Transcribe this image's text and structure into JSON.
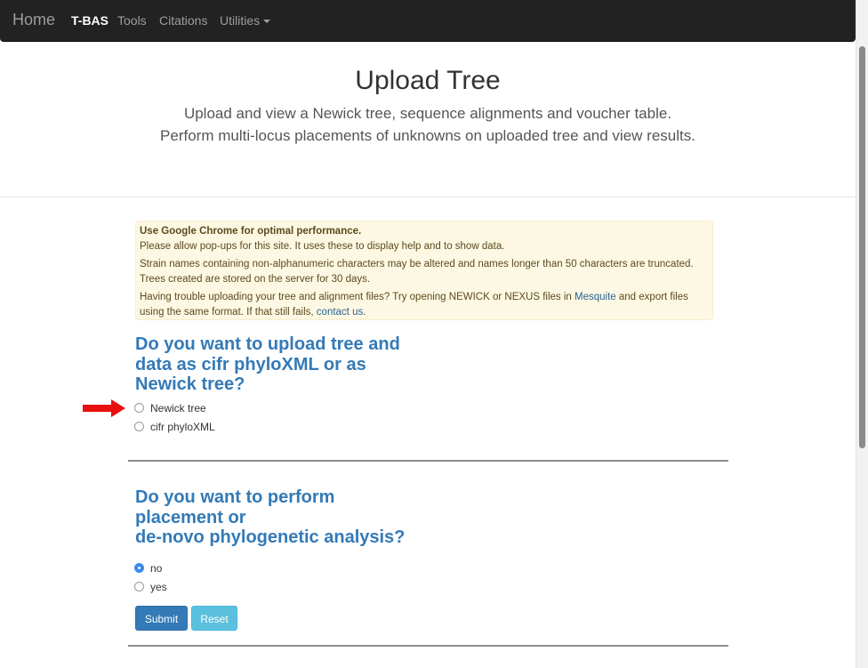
{
  "navbar": {
    "brand": "Home",
    "items": [
      {
        "label": "T-BAS",
        "active": true
      },
      {
        "label": "Tools"
      },
      {
        "label": "Citations"
      },
      {
        "label": "Utilities"
      }
    ]
  },
  "hero": {
    "title": "Upload Tree",
    "line1": "Upload and view a Newick tree, sequence alignments and voucher table.",
    "line2": "Perform multi-locus placements of unknowns on uploaded tree and view results."
  },
  "alert": {
    "heading": "Use Google Chrome for optimal performance.",
    "line1": "Please allow pop-ups for this site. It uses these to display help and to show data.",
    "line2": "Strain names containing non-alphanumeric characters may be altered and names longer than 50 characters are truncated.",
    "line3": "Trees created are stored on the server for 30 days.",
    "line4_pre": "Having trouble uploading your tree and alignment files? Try opening NEWICK or NEXUS files in",
    "line4_link": "Mesquite",
    "line4_post": "and export files",
    "line5_pre": "using the same format. If that still fails,",
    "line5_link": "contact us",
    "line5_post": "."
  },
  "upload_format": {
    "question_lines": [
      "Do you want to upload tree and",
      "data as cifr phyloXML or as",
      "Newick tree?"
    ],
    "options": [
      {
        "label": "Newick tree",
        "checked": false
      },
      {
        "label": "cifr phyloXML",
        "checked": false
      }
    ]
  },
  "analysis": {
    "question_lines": [
      "Do you want to perform",
      "placement or",
      "de-novo phylogenetic analysis?"
    ],
    "options": [
      {
        "label": "no",
        "checked": true
      },
      {
        "label": "yes",
        "checked": false
      }
    ]
  },
  "buttons": {
    "submit": "Submit",
    "reset": "Reset"
  },
  "colors": {
    "navbar": "#222222",
    "heading_blue": "#337ab7",
    "alert_bg": "#fcf8e3",
    "arrow": "#e8100f",
    "radio_checked": "#3b8beb"
  }
}
